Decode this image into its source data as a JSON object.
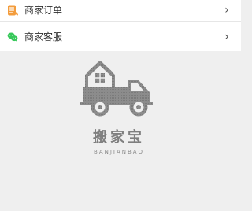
{
  "menu": {
    "items": [
      {
        "label": "商家订单",
        "icon": "order-icon",
        "icon_color": "#f39c3c",
        "chevron": "›"
      },
      {
        "label": "商家客服",
        "icon": "wechat-icon",
        "icon_color": "#37c85a",
        "chevron": "›"
      }
    ]
  },
  "empty_state": {
    "logo_icon": "moving-truck-logo",
    "brand_cn": "搬家宝",
    "brand_pinyin": "BANJIANBAO",
    "logo_color": "#8c8c8c"
  }
}
